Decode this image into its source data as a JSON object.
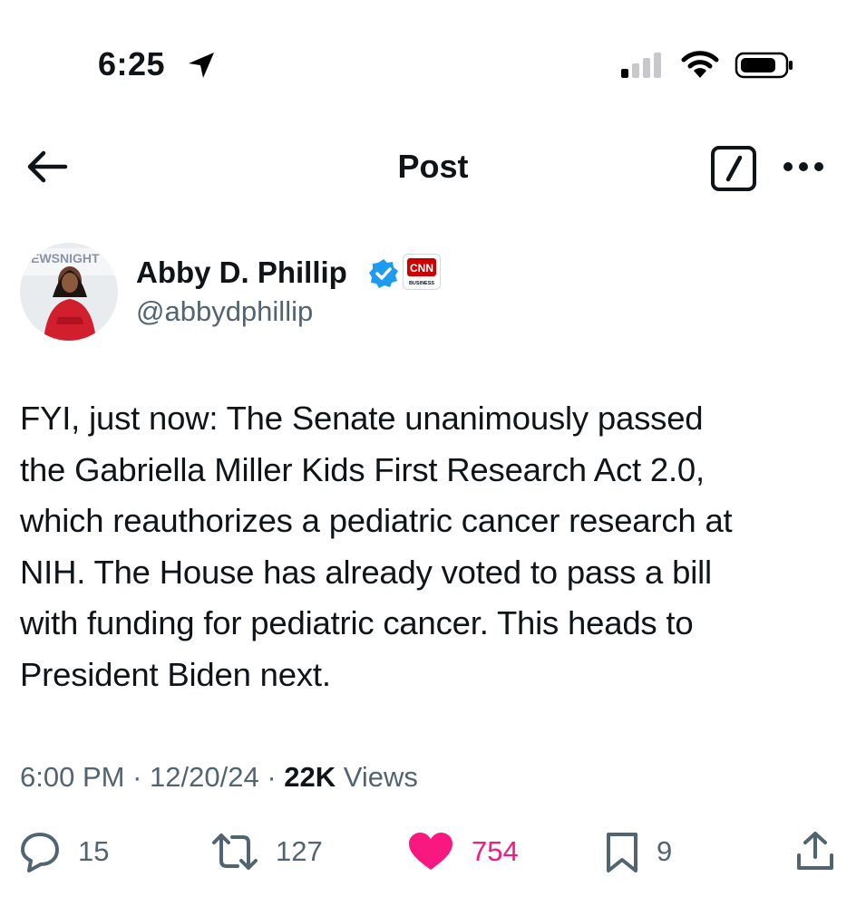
{
  "status_bar": {
    "time": "6:25",
    "icons": [
      "location-arrow-icon",
      "cellular-signal-icon",
      "wifi-icon",
      "battery-icon"
    ]
  },
  "header": {
    "title": "Post",
    "back_icon": "arrow-left-icon",
    "compose_icon": "compose-icon",
    "more_icon": "more-horizontal-icon"
  },
  "author": {
    "name": "Abby D. Phillip",
    "handle": "@abbydphillip",
    "verified": true,
    "affiliate_badge": "CNN BUSINESS",
    "avatar_text": "NEWSNIGHT"
  },
  "post": {
    "text": "FYI, just now: The Senate unanimously passed\nthe Gabriella Miller Kids First Research Act 2.0,\nwhich reauthorizes a pediatric cancer research at\nNIH. The House has already voted to pass a bill\nwith funding for pediatric cancer. This heads to\nPresident Biden next.",
    "time": "6:00 PM",
    "date": "12/20/24",
    "views_count": "22K",
    "views_label": "Views",
    "separator": "·"
  },
  "actions": {
    "replies": "15",
    "reposts": "127",
    "likes": "754",
    "bookmarks": "9"
  },
  "colors": {
    "text": "#0f1419",
    "secondary": "#536471",
    "like": "#f91880",
    "verified": "#1d9bf0",
    "cnn_red": "#cc0000"
  }
}
